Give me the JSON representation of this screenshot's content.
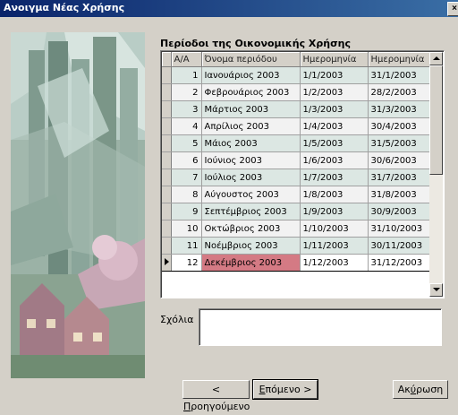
{
  "window": {
    "title": "Ανοιγμα Νέας Χρήσης",
    "close_label": "×"
  },
  "section_title": "Περίοδοι της Οικονομικής Χρήσης",
  "grid": {
    "columns": [
      "Α/Α",
      "Όνομα περιόδου",
      "Ημερομηνία",
      "Ημερομηνία"
    ],
    "rows": [
      {
        "aa": "1",
        "name": "Ιανουάριος 2003",
        "from": "1/1/2003",
        "to": "31/1/2003"
      },
      {
        "aa": "2",
        "name": "Φεβρουάριος 2003",
        "from": "1/2/2003",
        "to": "28/2/2003"
      },
      {
        "aa": "3",
        "name": "Μάρτιος 2003",
        "from": "1/3/2003",
        "to": "31/3/2003"
      },
      {
        "aa": "4",
        "name": "Απρίλιος 2003",
        "from": "1/4/2003",
        "to": "30/4/2003"
      },
      {
        "aa": "5",
        "name": "Μάιος 2003",
        "from": "1/5/2003",
        "to": "31/5/2003"
      },
      {
        "aa": "6",
        "name": "Ιούνιος 2003",
        "from": "1/6/2003",
        "to": "30/6/2003"
      },
      {
        "aa": "7",
        "name": "Ιούλιος 2003",
        "from": "1/7/2003",
        "to": "31/7/2003"
      },
      {
        "aa": "8",
        "name": "Αύγουστος 2003",
        "from": "1/8/2003",
        "to": "31/8/2003"
      },
      {
        "aa": "9",
        "name": "Σεπτέμβριος 2003",
        "from": "1/9/2003",
        "to": "30/9/2003"
      },
      {
        "aa": "10",
        "name": "Οκτώβριος 2003",
        "from": "1/10/2003",
        "to": "31/10/2003"
      },
      {
        "aa": "11",
        "name": "Νοέμβριος 2003",
        "from": "1/11/2003",
        "to": "30/11/2003"
      },
      {
        "aa": "12",
        "name": "Δεκέμβριος 2003",
        "from": "1/12/2003",
        "to": "31/12/2003"
      }
    ],
    "current_row": 12
  },
  "notes": {
    "label": "Σχόλια",
    "value": ""
  },
  "buttons": {
    "prev": {
      "hotkey": "<",
      "pre": " ",
      "u": "Π",
      "post": "ροηγούμενο"
    },
    "next": {
      "u": "Ε",
      "post": "πόμενο >"
    },
    "cancel": {
      "pre": "Ακ",
      "u": "ύ",
      "post": "ρωση"
    }
  },
  "colors": {
    "title_bar": "#0a246a",
    "selected_cell": "#d47a84",
    "row_alt": "#dce7e3"
  }
}
